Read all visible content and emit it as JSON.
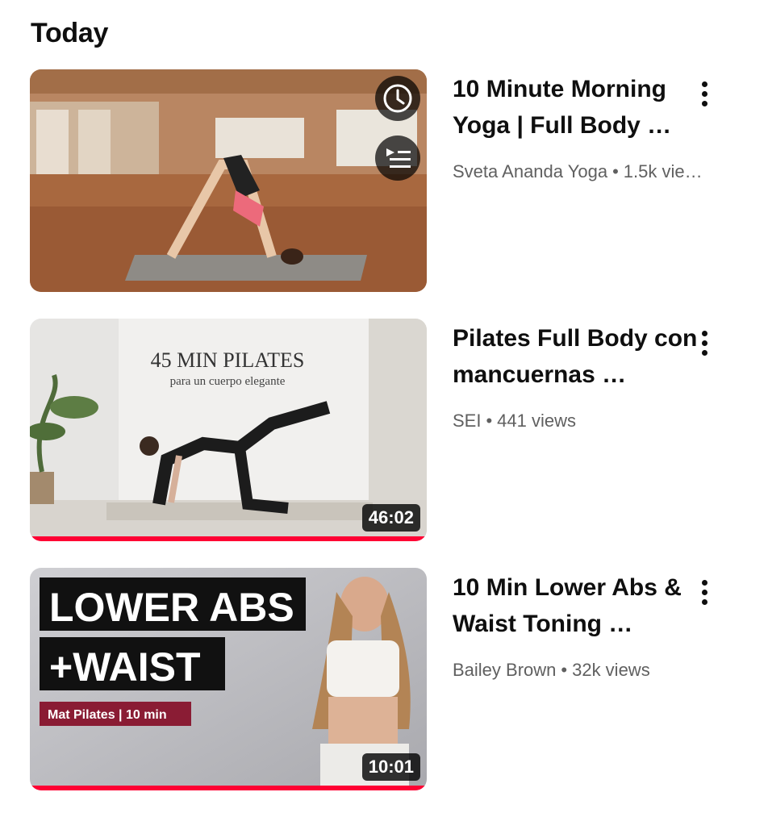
{
  "section": {
    "title": "Today"
  },
  "videos": [
    {
      "title": "10 Minute Morning Yoga | Full Body …",
      "channel": "Sveta Ananda Yoga",
      "views": "1.5k vie…",
      "duration": "",
      "progress": 0,
      "thumb_overlay_icons": [
        "watch-later-icon",
        "add-to-queue-icon"
      ]
    },
    {
      "title": "Pilates Full Body con mancuernas …",
      "channel": "SEI",
      "views": "441 views",
      "duration": "46:02",
      "progress": 1,
      "thumb_text": {
        "line1": "45 MIN PILATES",
        "line2": "para un cuerpo elegante"
      }
    },
    {
      "title": "10 Min Lower Abs & Waist Toning …",
      "channel": "Bailey Brown",
      "views": "32k views",
      "duration": "10:01",
      "progress": 1,
      "thumb_text": {
        "line1": "LOWER ABS",
        "line2": "+WAIST",
        "tag": "Mat Pilates | 10 min"
      }
    }
  ],
  "colors": {
    "progress": "#ff0033",
    "secondary_text": "#606060"
  }
}
